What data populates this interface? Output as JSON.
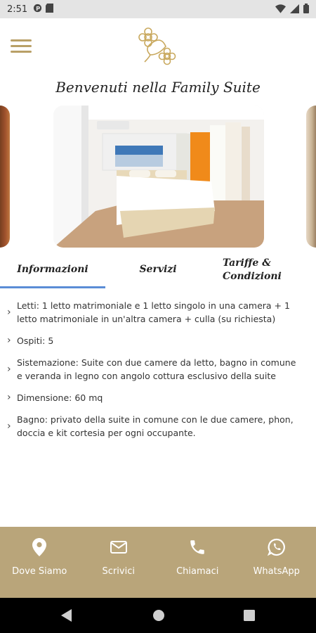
{
  "status_bar": {
    "time": "2:51",
    "icons": [
      "app-notification-icon",
      "sd-card-icon",
      "wifi-icon",
      "signal-icon",
      "battery-icon"
    ]
  },
  "header": {
    "menu_icon": "hamburger-menu-icon",
    "logo_icon": "flower-logo-icon"
  },
  "page": {
    "title": "Benvenuti nella Family Suite"
  },
  "tabs": [
    {
      "label": "Informazioni",
      "active": true
    },
    {
      "label": "Servizi",
      "active": false
    },
    {
      "label_line1": "Tariffe &",
      "label_line2": "Condizioni",
      "active": false
    }
  ],
  "info": [
    {
      "text": "Letti: 1 letto matrimoniale e 1 letto singolo in una camera + 1 letto matrimoniale in un'altra camera + culla (su richiesta)"
    },
    {
      "text": "Ospiti: 5"
    },
    {
      "text": "Sistemazione: Suite con due camere da letto, bagno in comune e veranda in legno con angolo cottura esclusivo della suite"
    },
    {
      "text": "Dimensione: 60 mq"
    },
    {
      "text": "Bagno: privato della suite in comune con le due camere, phon, doccia e kit cortesia per ogni occupante."
    }
  ],
  "bottom_bar": {
    "items": [
      {
        "label": "Dove Siamo",
        "icon": "location-pin-icon"
      },
      {
        "label": "Scrivici",
        "icon": "mail-icon"
      },
      {
        "label": "Chiamaci",
        "icon": "phone-icon"
      },
      {
        "label": "WhatsApp",
        "icon": "whatsapp-icon"
      }
    ]
  },
  "colors": {
    "accent_gold": "#b9a57a",
    "tab_underline": "#5b8dd6",
    "nav_bar": "#000000"
  }
}
